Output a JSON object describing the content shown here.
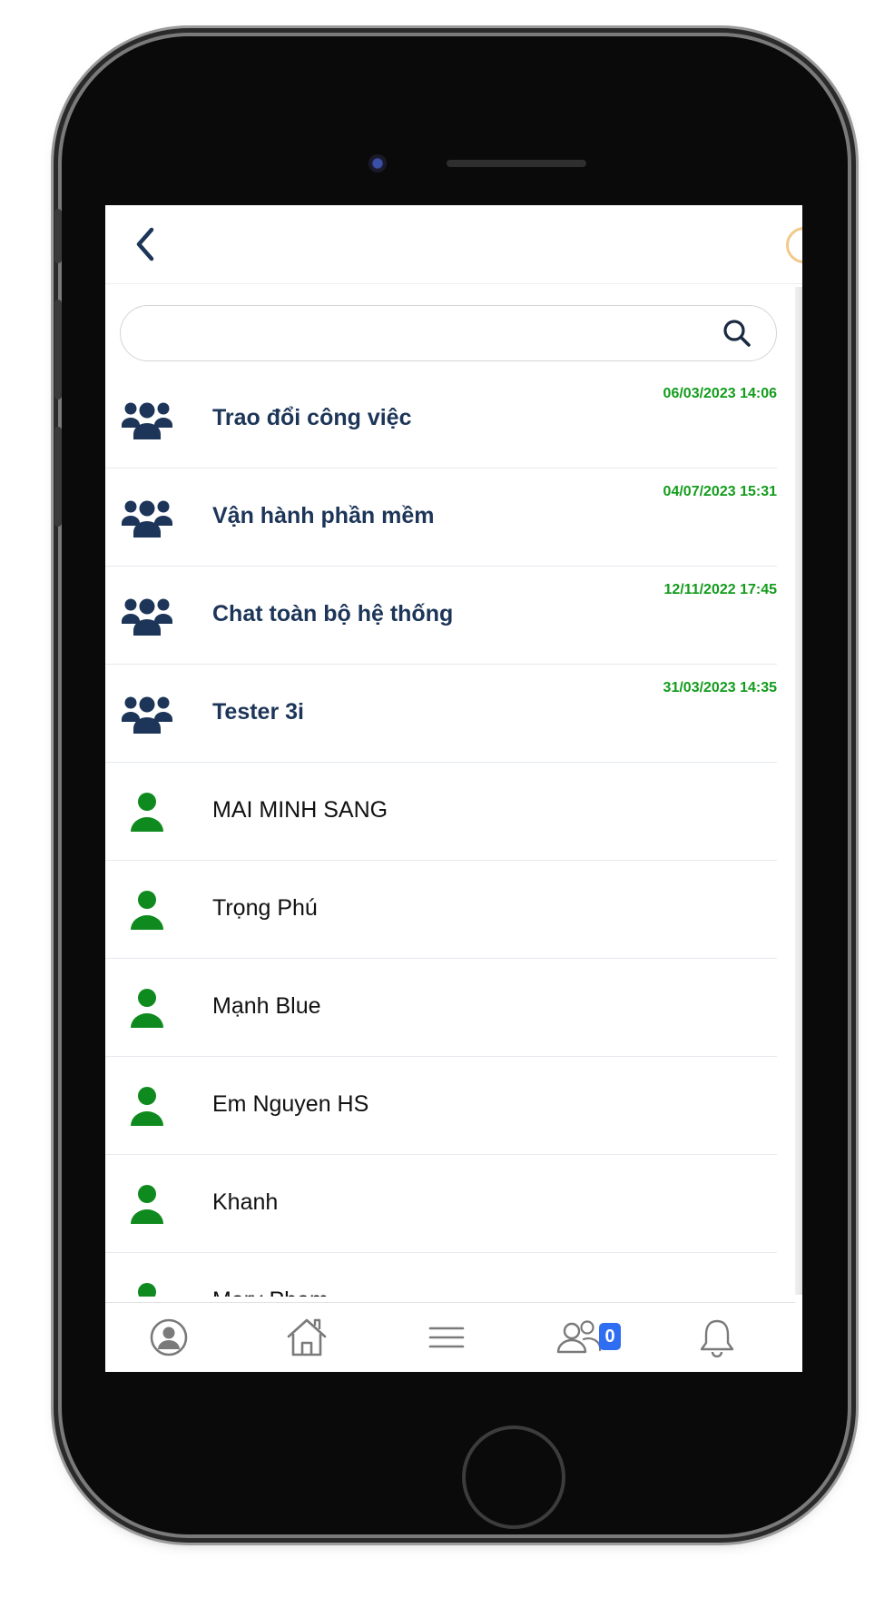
{
  "search": {
    "placeholder": ""
  },
  "chats": [
    {
      "type": "group",
      "name": "Trao đổi công việc",
      "time": "06/03/2023 14:06"
    },
    {
      "type": "group",
      "name": "Vận hành phần mềm",
      "time": "04/07/2023 15:31"
    },
    {
      "type": "group",
      "name": "Chat toàn bộ hệ thống",
      "time": "12/11/2022 17:45"
    },
    {
      "type": "group",
      "name": "Tester 3i",
      "time": "31/03/2023 14:35"
    },
    {
      "type": "person",
      "name": "MAI MINH SANG",
      "time": ""
    },
    {
      "type": "person",
      "name": "Trọng Phú",
      "time": ""
    },
    {
      "type": "person",
      "name": "Mạnh Blue",
      "time": ""
    },
    {
      "type": "person",
      "name": "Em Nguyen HS",
      "time": ""
    },
    {
      "type": "person",
      "name": "Khanh",
      "time": ""
    },
    {
      "type": "person",
      "name": "Mary Pham",
      "time": ""
    }
  ],
  "bottom_nav": {
    "items": [
      "profile-icon",
      "home-icon",
      "menu-icon",
      "contacts-icon",
      "bell-icon"
    ],
    "contacts_badge": "0"
  },
  "colors": {
    "group_name": "#1c3558",
    "group_icon": "#1c3558",
    "person_icon": "#0f8a1e",
    "timestamp": "#139c1c",
    "badge": "#2f6df2"
  }
}
